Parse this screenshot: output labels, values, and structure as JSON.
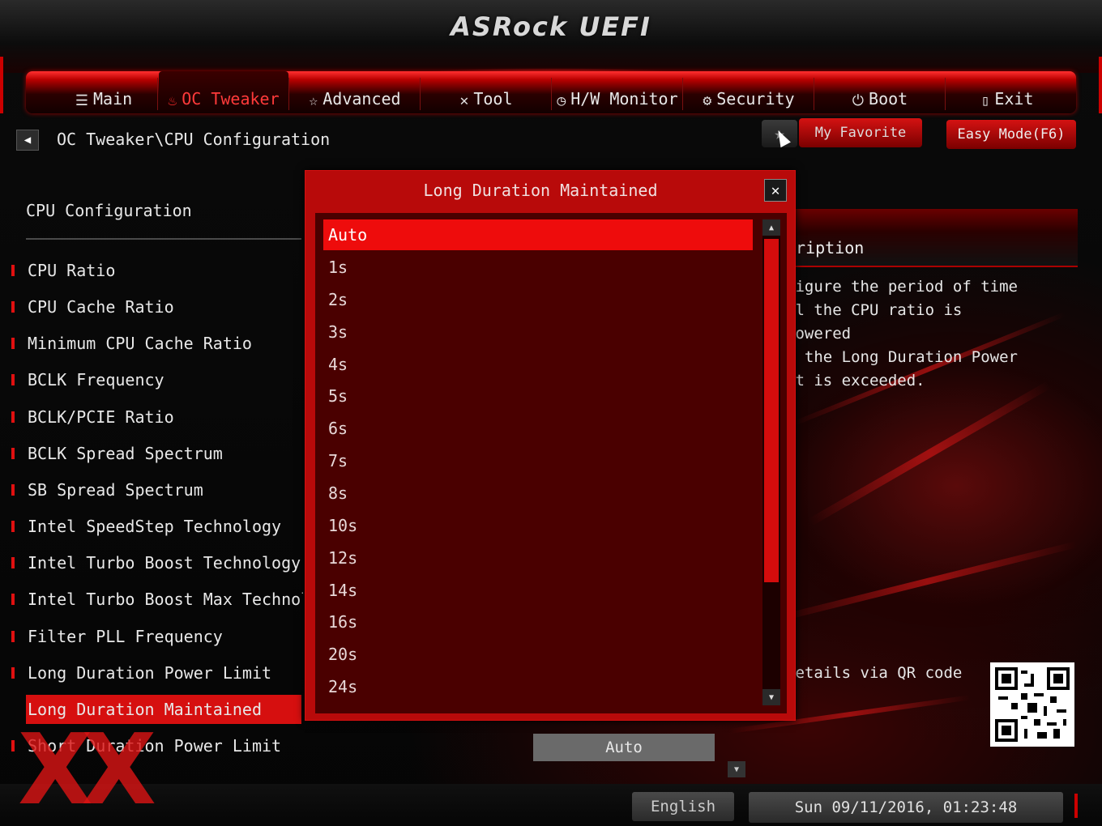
{
  "app": {
    "title": "ASRock UEFI"
  },
  "nav": {
    "items": [
      {
        "label": "Main",
        "icon": "list-icon",
        "active": false
      },
      {
        "label": "OC Tweaker",
        "icon": "flame-icon",
        "active": true
      },
      {
        "label": "Advanced",
        "icon": "star-icon",
        "active": false
      },
      {
        "label": "Tool",
        "icon": "tools-icon",
        "active": false
      },
      {
        "label": "H/W Monitor",
        "icon": "monitor-icon",
        "active": false
      },
      {
        "label": "Security",
        "icon": "shield-icon",
        "active": false
      },
      {
        "label": "Boot",
        "icon": "power-icon",
        "active": false
      },
      {
        "label": "Exit",
        "icon": "exit-icon",
        "active": false
      }
    ]
  },
  "breadcrumb": "OC Tweaker\\CPU Configuration",
  "buttons": {
    "favorite": "My Favorite",
    "easy_mode": "Easy Mode(F6)"
  },
  "menu": {
    "title": "CPU Configuration",
    "items": [
      "CPU Ratio",
      "CPU Cache Ratio",
      "Minimum CPU Cache Ratio",
      "BCLK Frequency",
      "BCLK/PCIE Ratio",
      "BCLK Spread Spectrum",
      "SB Spread Spectrum",
      "Intel SpeedStep Technology",
      "Intel Turbo Boost Technology",
      "Intel Turbo Boost Max Technology",
      "Filter PLL Frequency",
      "Long Duration Power Limit",
      "Long Duration Maintained",
      "Short Duration Power Limit"
    ],
    "selected": "Long Duration Maintained"
  },
  "description": {
    "title": "cription",
    "lines": [
      "figure the period of time",
      "il the CPU ratio is lowered",
      "n the Long Duration Power",
      "it is exceeded."
    ],
    "qr_label": "details via QR code"
  },
  "value_box": "Auto",
  "modal": {
    "title": "Long Duration Maintained",
    "options": [
      "Auto",
      "1s",
      "2s",
      "3s",
      "4s",
      "5s",
      "6s",
      "7s",
      "8s",
      "10s",
      "12s",
      "14s",
      "16s",
      "20s",
      "24s"
    ],
    "selected": "Auto"
  },
  "footer": {
    "language": "English",
    "datetime": "Sun 09/11/2016, 01:23:48"
  },
  "colors": {
    "accent": "#d60f0f",
    "modal_bg": "#b80a0a",
    "list_bg": "#4a0000"
  }
}
